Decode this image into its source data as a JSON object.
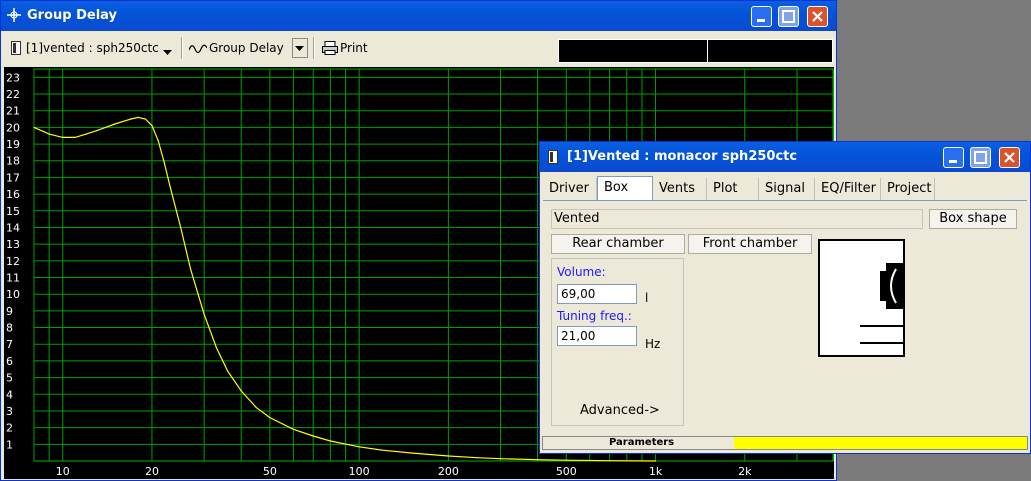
{
  "group_delay_window": {
    "title": "Group Delay",
    "toolbar": {
      "project_select": "[1]vented : sph250ctc",
      "plot_select": "Group Delay",
      "print_label": "Print"
    }
  },
  "chart_data": {
    "type": "line",
    "title": "",
    "xlabel": "",
    "ylabel": "",
    "x_scale": "log",
    "xlim": [
      8,
      4000
    ],
    "ylim": [
      0,
      23.5
    ],
    "grid": true,
    "x_tick_labels": [
      {
        "value": 10,
        "label": "10"
      },
      {
        "value": 20,
        "label": "20"
      },
      {
        "value": 50,
        "label": "50"
      },
      {
        "value": 100,
        "label": "100"
      },
      {
        "value": 200,
        "label": "200"
      },
      {
        "value": 500,
        "label": "500"
      },
      {
        "value": 1000,
        "label": "1k"
      },
      {
        "value": 2000,
        "label": "2k"
      }
    ],
    "y_tick_labels": [
      "1",
      "2",
      "3",
      "4",
      "5",
      "6",
      "7",
      "8",
      "9",
      "10",
      "11",
      "12",
      "13",
      "14",
      "15",
      "16",
      "17",
      "18",
      "19",
      "20",
      "21",
      "22",
      "23"
    ],
    "series": [
      {
        "color": "#ffff00",
        "x": [
          8,
          9,
          10,
          11,
          12,
          13,
          15,
          17,
          18,
          19,
          20,
          21,
          22,
          23,
          25,
          27,
          30,
          33,
          36,
          40,
          45,
          50,
          60,
          70,
          80,
          100,
          120,
          150,
          200,
          250,
          300,
          400,
          500,
          700,
          1000
        ],
        "y": [
          20.0,
          19.6,
          19.4,
          19.4,
          19.6,
          19.8,
          20.2,
          20.5,
          20.6,
          20.5,
          20.1,
          19.2,
          17.9,
          16.5,
          14.0,
          11.5,
          8.8,
          6.8,
          5.4,
          4.2,
          3.2,
          2.6,
          1.9,
          1.5,
          1.2,
          0.85,
          0.65,
          0.48,
          0.3,
          0.2,
          0.14,
          0.08,
          0.05,
          0.02,
          0.0
        ]
      }
    ]
  },
  "box_window": {
    "title": "[1]Vented : monacor sph250ctc",
    "tabs": [
      "Driver",
      "Box",
      "Vents",
      "Plot",
      "Signal",
      "EQ/Filter",
      "Project"
    ],
    "active_tab": "Box",
    "box_type": "Vented",
    "box_shape_button": "Box shape",
    "rear_chamber_button": "Rear chamber",
    "front_chamber_button": "Front chamber",
    "volume_label": "Volume:",
    "volume_value": "69,00",
    "volume_unit": "l",
    "tuning_label": "Tuning freq.:",
    "tuning_value": "21,00",
    "tuning_unit": "Hz",
    "advanced_label": "Advanced->",
    "status_label": "Parameters",
    "status_color": "#ffff00",
    "label_color": "#1a1aff"
  }
}
